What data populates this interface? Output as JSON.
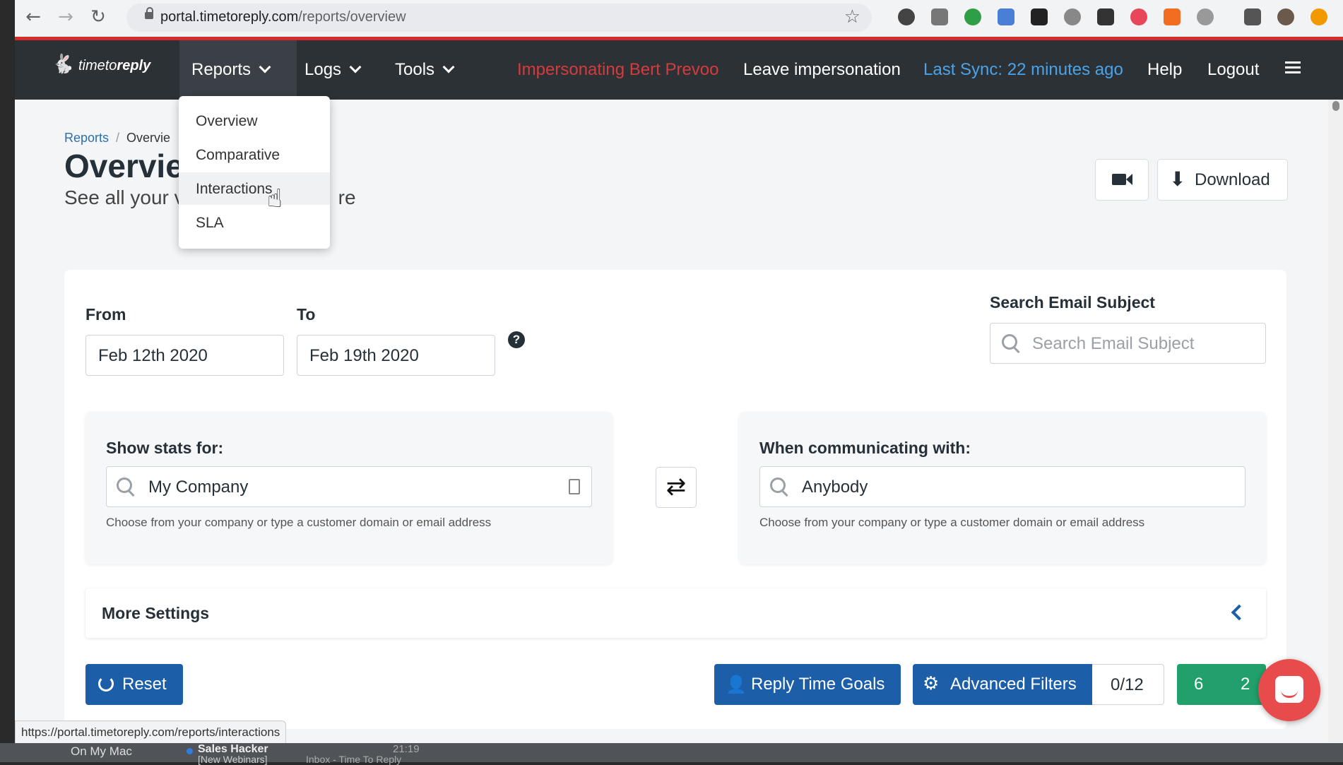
{
  "browser": {
    "url_host": "portal.timetoreply.com",
    "url_path": "/reports/overview",
    "status_url": "https://portal.timetoreply.com/reports/interactions"
  },
  "navbar": {
    "logo": {
      "light": "timeto",
      "bold": "reply"
    },
    "reports": "Reports",
    "logs": "Logs",
    "tools": "Tools",
    "impersonating": "Impersonating Bert Prevoo",
    "leave": "Leave impersonation",
    "last_sync": "Last Sync: 22 minutes ago",
    "help": "Help",
    "logout": "Logout",
    "colors": {
      "bg": "#2c3136",
      "impersonating": "#d63b3b",
      "sync": "#4aa3e8"
    }
  },
  "dropdown": {
    "items": [
      "Overview",
      "Comparative",
      "Interactions",
      "SLA"
    ],
    "hovered": "Interactions"
  },
  "breadcrumb": {
    "root": "Reports",
    "separator": "/",
    "current": "Overvie"
  },
  "page": {
    "title": "Overvie",
    "subtitle_a": "See all your v",
    "subtitle_b": "re",
    "download": "Download"
  },
  "filters": {
    "from_label": "From",
    "from_value": "Feb 12th 2020",
    "to_label": "To",
    "to_value": "Feb 19th 2020",
    "search_label": "Search Email Subject",
    "search_placeholder": "Search Email Subject",
    "show_stats_label": "Show stats for:",
    "show_stats_value": "My Company",
    "show_stats_hint": "Choose from your company or type a customer domain or email address",
    "communicating_label": "When communicating with:",
    "communicating_value": "Anybody",
    "communicating_hint": "Choose from your company or type a customer domain or email address",
    "more_settings": "More Settings"
  },
  "actions": {
    "reset": "Reset",
    "reply_time_goals": "Reply Time Goals",
    "advanced_filters": "Advanced Filters",
    "filter_count": "0/12",
    "green_a": "6",
    "green_b": "2"
  },
  "dock": {
    "folder": "On My Mac",
    "mail_from": "Sales Hacker",
    "mail_subject": "[New Webinars]",
    "mail_box": "Inbox - Time To Reply",
    "mail_time": "21:19"
  }
}
